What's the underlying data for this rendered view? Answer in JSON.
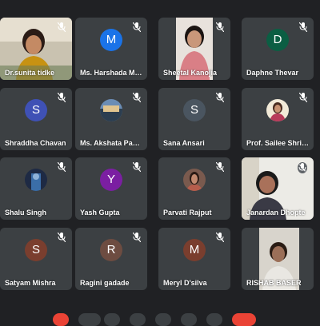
{
  "participants": [
    {
      "name": "Dr.sunita tidke",
      "type": "video",
      "muted": true
    },
    {
      "name": "Ms. Harshada M…",
      "type": "initial",
      "initial": "M",
      "color": "#1a73e8",
      "muted": true
    },
    {
      "name": "Sheetal Kanojia",
      "type": "video",
      "muted": true
    },
    {
      "name": "Daphne Thevar",
      "type": "initial",
      "initial": "D",
      "color": "#0b5e43",
      "muted": true
    },
    {
      "name": "Shraddha Chavan",
      "type": "initial",
      "initial": "S",
      "color": "#3f51b5",
      "muted": true
    },
    {
      "name": "Ms. Akshata Paw…",
      "type": "photo",
      "muted": true
    },
    {
      "name": "Sana Ansari",
      "type": "initial",
      "initial": "S",
      "color": "#4a5560",
      "muted": true
    },
    {
      "name": "Prof. Sailee Shrin…",
      "type": "photo",
      "muted": true
    },
    {
      "name": "Shalu Singh",
      "type": "photo",
      "muted": true
    },
    {
      "name": "Yash Gupta",
      "type": "initial",
      "initial": "Y",
      "color": "#7b1fa2",
      "muted": true
    },
    {
      "name": "Parvati Rajput",
      "type": "photo",
      "muted": true
    },
    {
      "name": "Janardan Dhopte",
      "type": "video",
      "muted": true
    },
    {
      "name": "Satyam Mishra",
      "type": "initial",
      "initial": "S",
      "color": "#7a3e2e",
      "muted": true
    },
    {
      "name": "Ragini gadade",
      "type": "initial",
      "initial": "R",
      "color": "#6d4c41",
      "muted": true
    },
    {
      "name": "Meryl D'silva",
      "type": "initial",
      "initial": "M",
      "color": "#7a3e2e",
      "muted": true
    },
    {
      "name": "RISHAB BASER",
      "type": "video",
      "muted": false
    }
  ]
}
